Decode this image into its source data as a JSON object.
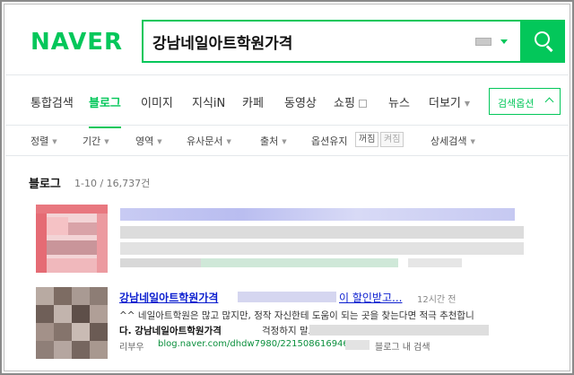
{
  "logo": {
    "text": "NAVER"
  },
  "search": {
    "query": "강남네일아트학원가격"
  },
  "tabs": [
    {
      "label": "통합검색"
    },
    {
      "label": "블로그"
    },
    {
      "label": "이미지"
    },
    {
      "label": "지식iN"
    },
    {
      "label": "카페"
    },
    {
      "label": "동영상"
    },
    {
      "label": "쇼핑"
    },
    {
      "label": "뉴스"
    },
    {
      "label": "더보기"
    }
  ],
  "search_options": {
    "label": "검색옵션"
  },
  "filters": {
    "items": [
      "정렬",
      "기간",
      "영역",
      "유사문서",
      "출처"
    ],
    "options_keep": {
      "label": "옵션유지",
      "on": "꺼짐",
      "off": "켜짐"
    },
    "advanced": "상세검색"
  },
  "section": {
    "title": "블로그",
    "count": "1-10 / 16,737건"
  },
  "results": [
    {
      "title": "강남네일아트학원가격",
      "title_rest": "이 할인받고...",
      "time": "12시간 전",
      "snippet_line1": "^^ 네일아트학원은 많고 많지만, 정작 자신한테 도움이 되는 곳을 찾는다면 적극 추천합니",
      "snippet_line2_strong": "다. 강남네일아트학원가격",
      "snippet_line2_rest": " 걱정하지 말고",
      "author": "리부우",
      "url": "blog.naver.com/dhdw7980/221508616946",
      "search_in_blog": "블로그 내 검색"
    }
  ],
  "colors": {
    "brand": "#03c75a",
    "link": "#0b1ecf",
    "url": "#0a8f3c"
  }
}
